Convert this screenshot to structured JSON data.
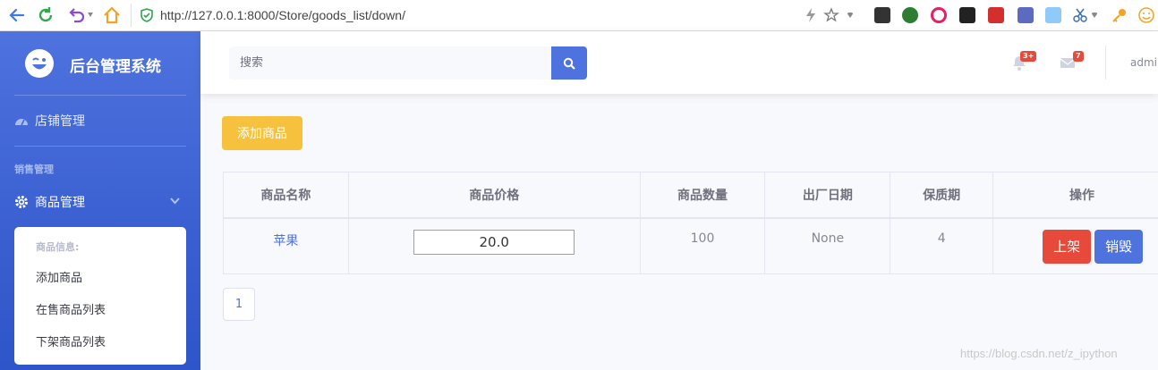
{
  "browser": {
    "url": "http://127.0.0.1:8000/Store/goods_list/down/"
  },
  "sidebar": {
    "brand": "后台管理系统",
    "store_item": "店铺管理",
    "section_heading": "销售管理",
    "goods_item": "商品管理",
    "submenu": {
      "heading": "商品信息:",
      "items": [
        "添加商品",
        "在售商品列表",
        "下架商品列表"
      ]
    }
  },
  "topbar": {
    "search_placeholder": "搜索",
    "alerts_badge": "3+",
    "messages_badge": "7",
    "user_name": "admin"
  },
  "main": {
    "add_button": "添加商品",
    "table": {
      "headers": [
        "商品名称",
        "商品价格",
        "商品数量",
        "出厂日期",
        "保质期",
        "操作"
      ],
      "rows": [
        {
          "name": "苹果",
          "price": "20.0",
          "quantity": "100",
          "date": "None",
          "shelf_life": "4",
          "action_up": "上架",
          "action_destroy": "销毁"
        }
      ]
    },
    "pagination": [
      "1"
    ]
  },
  "watermark": "https://blog.csdn.net/z_ipython",
  "colors": {
    "primary": "#4e73df",
    "warning": "#f6c23e",
    "danger": "#e74a3b"
  }
}
